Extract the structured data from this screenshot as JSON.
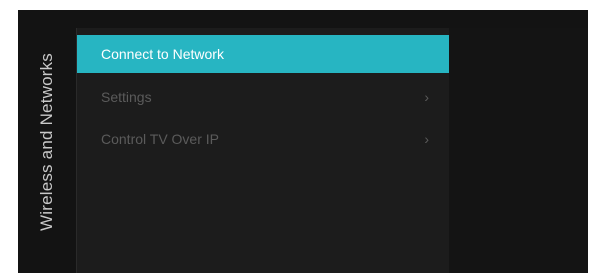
{
  "sidebar": {
    "title": "Wireless and Networks"
  },
  "menu": {
    "items": [
      {
        "label": "Connect to Network",
        "selected": true,
        "has_submenu": false
      },
      {
        "label": "Settings",
        "selected": false,
        "has_submenu": true,
        "chevron": "›"
      },
      {
        "label": "Control TV Over IP",
        "selected": false,
        "has_submenu": true,
        "chevron": "›"
      }
    ]
  },
  "colors": {
    "background": "#131313",
    "panel": "#1c1c1c",
    "highlight": "#27b5c2",
    "text_selected": "#ffffff",
    "text_dim": "#5b5b5b",
    "sidebar_text": "#c9c9c9"
  },
  "icons": {
    "submenu": "chevron-right-icon"
  }
}
